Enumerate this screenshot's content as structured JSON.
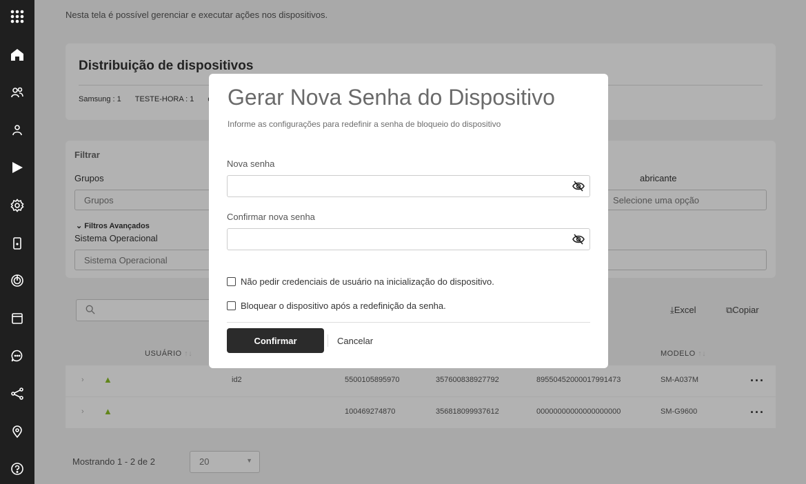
{
  "page": {
    "subtitle": "Nesta tela é possível gerenciar e executar ações nos dispositivos."
  },
  "sidebar": {
    "icons": [
      "apps-grid-icon",
      "home-icon",
      "users-icon",
      "user-icon",
      "play-store-icon",
      "settings-icon",
      "device-icon",
      "radar-icon",
      "calendar-icon",
      "chat-icon",
      "share-icon",
      "location-icon",
      "help-icon"
    ]
  },
  "distribution": {
    "title": "Distribuição de dispositivos",
    "items": [
      "Samsung : 1",
      "TESTE-HORA : 1",
      "d"
    ]
  },
  "filters": {
    "title": "Filtrar",
    "groups_label": "Grupos",
    "groups_placeholder": "Grupos",
    "manufacturer_label": "abricante",
    "manufacturer_placeholder": "Selecione uma opção",
    "advanced_label": "Filtros Avançados",
    "os_label": "Sistema Operacional",
    "os_placeholder": "Sistema Operacional"
  },
  "toolbar": {
    "excel_label": "Excel",
    "copy_label": "Copiar"
  },
  "table": {
    "col_user": "USUÁRIO",
    "col_model": "MODELO",
    "rows": [
      {
        "user": "",
        "id": "id2",
        "phone": "5500105895970",
        "imei": "357600838927792",
        "iccid": "89550452000017991473",
        "model": "SM-A037M"
      },
      {
        "user": "",
        "id": "",
        "phone": "100469274870",
        "imei": "356818099937612",
        "iccid": "00000000000000000000",
        "model": "SM-G9600"
      }
    ]
  },
  "pagination": {
    "summary": "Mostrando 1 - 2 de 2",
    "page_size": "20"
  },
  "modal": {
    "title": "Gerar Nova Senha do Dispositivo",
    "subtitle": "Informe as configurações para redefinir a senha de bloqueio do dispositivo",
    "new_password_label": "Nova senha",
    "confirm_password_label": "Confirmar nova senha",
    "checkbox_no_credentials": "Não pedir credenciais de usuário na inicialização do dispositivo.",
    "checkbox_lock": "Bloquear o dispositivo após a redefinição da senha.",
    "confirm_button": "Confirmar",
    "cancel_button": "Cancelar"
  },
  "colors": {
    "sidebar": "#1f1f1f",
    "confirm": "#2b2b2b",
    "android": "#8cbf26"
  }
}
